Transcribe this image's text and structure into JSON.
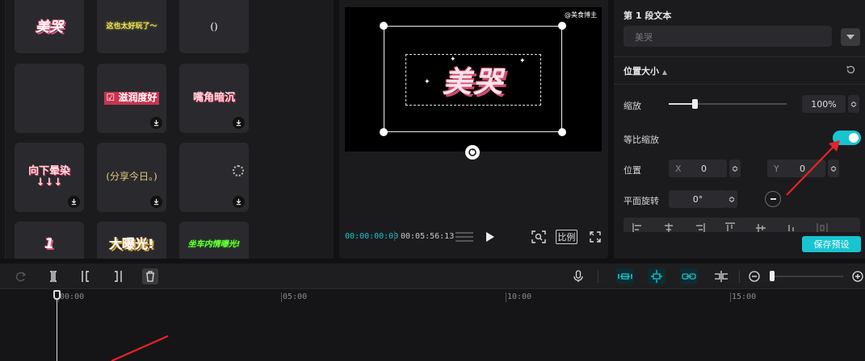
{
  "asset_tiles": [
    {
      "text": "美哭",
      "style": "t-pink",
      "download": false
    },
    {
      "text": "这也太好玩了～",
      "style": "t-yellow",
      "download": false
    },
    {
      "text": "()",
      "style": "t-slim",
      "download": false
    },
    {
      "text": "",
      "style": "",
      "download": false
    },
    {
      "text": "☑ 滋润度好",
      "style": "t-red",
      "download": true
    },
    {
      "text": "嘴角暗沉",
      "style": "t-banner",
      "download": true
    },
    {
      "text": "向下晕染\n↓↓↓",
      "style": "t-banner",
      "download": true
    },
    {
      "text": "(分享今日。)",
      "style": "t-caption",
      "download": true
    },
    {
      "text": "",
      "style": "",
      "download": true
    },
    {
      "text": "1",
      "style": "t-pink",
      "download": false
    },
    {
      "text": "大曝光!",
      "style": "t-big",
      "download": false
    },
    {
      "text": "坐车内情曝光!",
      "style": "t-green",
      "download": false
    }
  ],
  "preview": {
    "watermark": "@美食博主",
    "video_text": "美哭",
    "timecode_current": "00:00:00:00",
    "timecode_total": "00:05:56:13",
    "ratio_label": "比例"
  },
  "properties": {
    "segment_title": "第 1 段文本",
    "segment_value": "美哭",
    "position_size_title": "位置大小",
    "scale_label": "缩放",
    "scale_value": "100%",
    "scale_fraction": 0.22,
    "lock_ratio_label": "等比缩放",
    "lock_ratio_on": true,
    "position_label": "位置",
    "x_label": "X",
    "x_value": "0",
    "y_label": "Y",
    "y_value": "0",
    "rotation_label": "平面旋转",
    "rotation_value": "0°",
    "save_preset_label": "保存预设"
  },
  "timeline": {
    "ticks": [
      "00:00",
      "05:00",
      "10:00",
      "15:00"
    ]
  },
  "colors": {
    "accent": "#17c4d0",
    "annotation": "#e8232a"
  }
}
